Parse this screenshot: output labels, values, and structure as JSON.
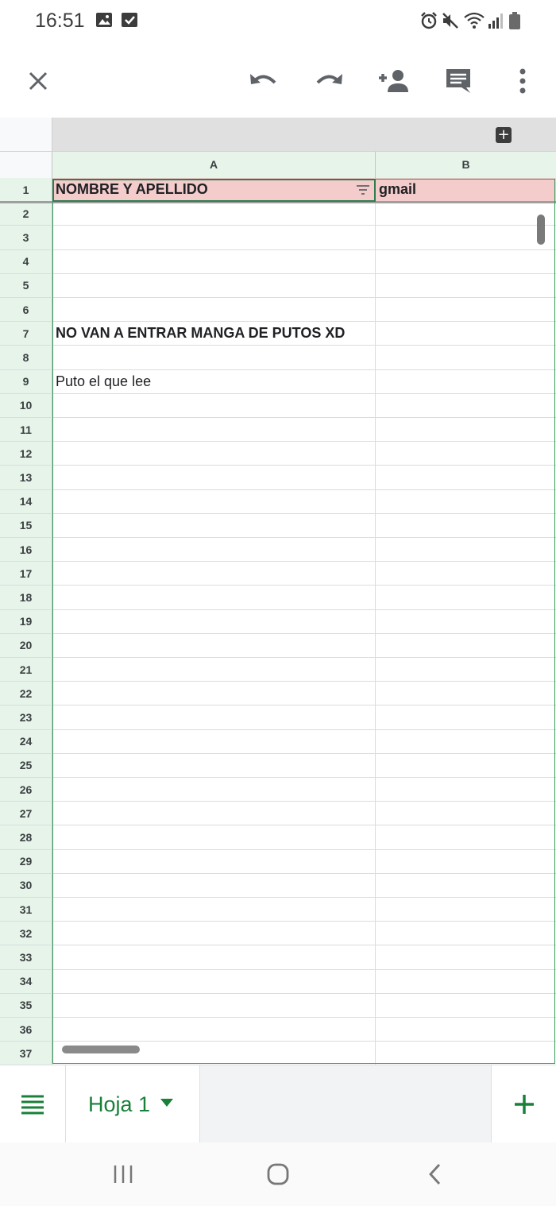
{
  "status_bar": {
    "time": "16:51",
    "left_icons": [
      "image-icon",
      "check-box-icon"
    ],
    "right_icons": [
      "alarm-icon",
      "mute-icon",
      "wifi-icon",
      "signal-icon",
      "battery-icon"
    ]
  },
  "toolbar": {
    "icons": [
      "close-icon",
      "undo-icon",
      "redo-icon",
      "add-person-icon",
      "comment-icon",
      "more-vert-icon"
    ]
  },
  "sheet": {
    "columns": [
      "A",
      "B"
    ],
    "rows": [
      {
        "num": "1",
        "a": "NOMBRE Y APELLIDO",
        "b": "gmail"
      },
      {
        "num": "2",
        "a": "",
        "b": ""
      },
      {
        "num": "3",
        "a": "",
        "b": ""
      },
      {
        "num": "4",
        "a": "",
        "b": ""
      },
      {
        "num": "5",
        "a": "",
        "b": ""
      },
      {
        "num": "6",
        "a": "",
        "b": ""
      },
      {
        "num": "7",
        "a": "NO VAN A ENTRAR MANGA DE PUTOS XD",
        "b": ""
      },
      {
        "num": "8",
        "a": "",
        "b": ""
      },
      {
        "num": "9",
        "a": "Puto el que lee",
        "b": ""
      },
      {
        "num": "10",
        "a": "",
        "b": ""
      },
      {
        "num": "11",
        "a": "",
        "b": ""
      },
      {
        "num": "12",
        "a": "",
        "b": ""
      },
      {
        "num": "13",
        "a": "",
        "b": ""
      },
      {
        "num": "14",
        "a": "",
        "b": ""
      },
      {
        "num": "15",
        "a": "",
        "b": ""
      },
      {
        "num": "16",
        "a": "",
        "b": ""
      },
      {
        "num": "17",
        "a": "",
        "b": ""
      },
      {
        "num": "18",
        "a": "",
        "b": ""
      },
      {
        "num": "19",
        "a": "",
        "b": ""
      },
      {
        "num": "20",
        "a": "",
        "b": ""
      },
      {
        "num": "21",
        "a": "",
        "b": ""
      },
      {
        "num": "22",
        "a": "",
        "b": ""
      },
      {
        "num": "23",
        "a": "",
        "b": ""
      },
      {
        "num": "24",
        "a": "",
        "b": ""
      },
      {
        "num": "25",
        "a": "",
        "b": ""
      },
      {
        "num": "26",
        "a": "",
        "b": ""
      },
      {
        "num": "27",
        "a": "",
        "b": ""
      },
      {
        "num": "28",
        "a": "",
        "b": ""
      },
      {
        "num": "29",
        "a": "",
        "b": ""
      },
      {
        "num": "30",
        "a": "",
        "b": ""
      },
      {
        "num": "31",
        "a": "",
        "b": ""
      },
      {
        "num": "32",
        "a": "",
        "b": ""
      },
      {
        "num": "33",
        "a": "",
        "b": ""
      },
      {
        "num": "34",
        "a": "",
        "b": ""
      },
      {
        "num": "35",
        "a": "",
        "b": ""
      },
      {
        "num": "36",
        "a": "",
        "b": ""
      },
      {
        "num": "37",
        "a": "",
        "b": ""
      }
    ],
    "bold_rows": [
      "1",
      "7"
    ],
    "header_fill_color": "#f4cccc",
    "selection_color": "#2e7d4f",
    "header_band_color": "#e6f4ea"
  },
  "sheet_tabs": {
    "menu_icon": "sheet-list-icon",
    "active_tab": "Hoja 1",
    "dropdown_icon": "dropdown-triangle-icon",
    "add_icon": "add-sheet-icon",
    "accent_color": "#188038"
  },
  "nav_bar": {
    "icons": [
      "recent-apps-icon",
      "home-icon",
      "back-icon"
    ]
  }
}
